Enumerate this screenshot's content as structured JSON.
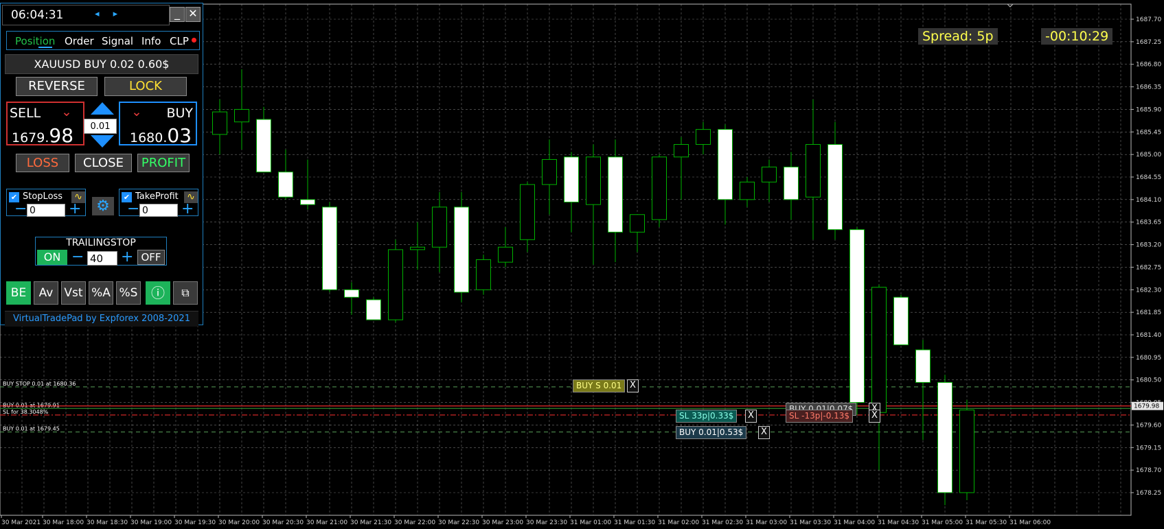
{
  "colors": {
    "background": "#000000",
    "grid": "#d0d0d0",
    "bull": "#00b300",
    "bear_body": "#ffffff",
    "accent_blue": "#1e90ff",
    "green_button": "#1db35a",
    "loss_text": "#ff6a3d",
    "lock_text": "#ffe033",
    "profit_text": "#33ff66",
    "hud_text": "#ffff4d",
    "bid_line": "#ff3030"
  },
  "hud": {
    "spread": "Spread: 5p",
    "timer": "-00:10:29"
  },
  "chart_data": {
    "type": "candlestick",
    "symbol": "XAUUSD",
    "y_ticks": [
      "1687.70",
      "1687.25",
      "1686.80",
      "1686.35",
      "1685.90",
      "1685.45",
      "1685.00",
      "1684.55",
      "1684.10",
      "1683.65",
      "1683.20",
      "1682.75",
      "1682.30",
      "1681.85",
      "1681.40",
      "1680.95",
      "1680.50",
      "1680.05",
      "1679.60",
      "1679.15",
      "1678.70",
      "1678.25"
    ],
    "ylim": [
      1677.9,
      1688.0
    ],
    "current_price_label": "1679.98",
    "x_ticks": [
      "30 Mar 2021",
      "30 Mar 18:00",
      "30 Mar 18:30",
      "30 Mar 19:00",
      "30 Mar 19:30",
      "30 Mar 20:00",
      "30 Mar 20:30",
      "30 Mar 21:00",
      "30 Mar 21:30",
      "30 Mar 22:00",
      "30 Mar 22:30",
      "30 Mar 23:00",
      "30 Mar 23:30",
      "31 Mar 01:00",
      "31 Mar 01:30",
      "31 Mar 02:00",
      "31 Mar 02:30",
      "31 Mar 03:00",
      "31 Mar 03:30",
      "31 Mar 04:00",
      "31 Mar 04:30",
      "31 Mar 05:00",
      "31 Mar 05:30",
      "31 Mar 06:00"
    ],
    "candles": [
      {
        "o": 1685.4,
        "h": 1686.1,
        "l": 1685.0,
        "c": 1685.85
      },
      {
        "o": 1685.65,
        "h": 1686.7,
        "l": 1685.1,
        "c": 1685.9
      },
      {
        "o": 1685.7,
        "h": 1685.95,
        "l": 1684.65,
        "c": 1684.65
      },
      {
        "o": 1684.65,
        "h": 1685.1,
        "l": 1684.1,
        "c": 1684.15
      },
      {
        "o": 1684.1,
        "h": 1684.9,
        "l": 1683.9,
        "c": 1684.0
      },
      {
        "o": 1683.95,
        "h": 1684.05,
        "l": 1682.25,
        "c": 1682.3
      },
      {
        "o": 1682.3,
        "h": 1682.45,
        "l": 1681.8,
        "c": 1682.15
      },
      {
        "o": 1682.1,
        "h": 1682.15,
        "l": 1681.75,
        "c": 1681.7
      },
      {
        "o": 1681.7,
        "h": 1683.3,
        "l": 1681.65,
        "c": 1683.1
      },
      {
        "o": 1683.1,
        "h": 1683.65,
        "l": 1682.7,
        "c": 1683.15
      },
      {
        "o": 1683.15,
        "h": 1684.25,
        "l": 1682.65,
        "c": 1683.95
      },
      {
        "o": 1683.95,
        "h": 1684.25,
        "l": 1682.05,
        "c": 1682.25
      },
      {
        "o": 1682.3,
        "h": 1683.0,
        "l": 1682.2,
        "c": 1682.9
      },
      {
        "o": 1682.85,
        "h": 1683.55,
        "l": 1682.75,
        "c": 1683.15
      },
      {
        "o": 1683.3,
        "h": 1684.45,
        "l": 1683.05,
        "c": 1684.4
      },
      {
        "o": 1684.4,
        "h": 1685.3,
        "l": 1683.8,
        "c": 1684.9
      },
      {
        "o": 1684.95,
        "h": 1685.05,
        "l": 1683.45,
        "c": 1684.05
      },
      {
        "o": 1684.0,
        "h": 1685.2,
        "l": 1682.8,
        "c": 1684.95
      },
      {
        "o": 1684.95,
        "h": 1685.3,
        "l": 1682.85,
        "c": 1683.45
      },
      {
        "o": 1683.45,
        "h": 1683.7,
        "l": 1683.05,
        "c": 1683.8
      },
      {
        "o": 1683.7,
        "h": 1685.0,
        "l": 1683.55,
        "c": 1684.95
      },
      {
        "o": 1684.95,
        "h": 1685.35,
        "l": 1684.1,
        "c": 1685.2
      },
      {
        "o": 1685.2,
        "h": 1685.65,
        "l": 1685.0,
        "c": 1685.5
      },
      {
        "o": 1685.5,
        "h": 1685.6,
        "l": 1683.6,
        "c": 1684.1
      },
      {
        "o": 1684.1,
        "h": 1684.55,
        "l": 1683.95,
        "c": 1684.45
      },
      {
        "o": 1684.45,
        "h": 1684.9,
        "l": 1684.05,
        "c": 1684.75
      },
      {
        "o": 1684.75,
        "h": 1685.05,
        "l": 1683.7,
        "c": 1684.1
      },
      {
        "o": 1684.15,
        "h": 1686.1,
        "l": 1683.3,
        "c": 1685.2
      },
      {
        "o": 1685.2,
        "h": 1685.65,
        "l": 1683.3,
        "c": 1683.5
      },
      {
        "o": 1683.5,
        "h": 1683.55,
        "l": 1679.8,
        "c": 1680.05
      },
      {
        "o": 1679.85,
        "h": 1682.4,
        "l": 1678.7,
        "c": 1682.35
      },
      {
        "o": 1682.15,
        "h": 1682.2,
        "l": 1681.2,
        "c": 1681.2
      },
      {
        "o": 1681.1,
        "h": 1681.3,
        "l": 1679.3,
        "c": 1680.45
      },
      {
        "o": 1680.45,
        "h": 1680.6,
        "l": 1678.0,
        "c": 1678.25
      },
      {
        "o": 1678.25,
        "h": 1680.1,
        "l": 1678.1,
        "c": 1679.9
      }
    ],
    "levels": [
      {
        "label": "BUY STOP 0.01 at 1680.36",
        "price": 1680.36,
        "style": "dashed",
        "color": "#5aa05a"
      },
      {
        "label": "BUY 0.01 at 1679.91",
        "price": 1679.93,
        "style": "solid",
        "color": "#2e8b2e"
      },
      {
        "label": "SL for 38.3048%",
        "price": 1679.8,
        "style": "dashdot",
        "color": "#ff3030"
      },
      {
        "label": "BUY 0.01 at 1679.45",
        "price": 1679.46,
        "style": "dashed",
        "color": "#5aa05a"
      },
      {
        "label": "",
        "price": 1679.98,
        "style": "solid",
        "color": "#ff3030"
      }
    ]
  },
  "order_tags": [
    {
      "name": "tag-buy-stop",
      "text": "BUY S 0.01",
      "bg": "#7a7a1a",
      "color": "#ffff88",
      "x_label": "X"
    },
    {
      "name": "tag-sl-33",
      "text": "SL 33p|0.33$",
      "bg": "#0b5a52",
      "color": "#8affe8",
      "x_label": "X"
    },
    {
      "name": "tag-buy-053",
      "text": "BUY 0.01|0.53$",
      "bg": "#1c3a4a",
      "color": "#ffffff",
      "x_label": "X"
    },
    {
      "name": "tag-buy-007",
      "text": "BUY 0.01|0.07$",
      "bg": "#404040",
      "color": "#e0e0e0",
      "x_label": "X"
    },
    {
      "name": "tag-sl-13",
      "text": "SL -13p|-0.13$",
      "bg": "#4a2020",
      "color": "#ff7a6a",
      "x_label": "X"
    }
  ],
  "panel": {
    "time": "06:04:31",
    "nav_arrows": "◂ ▸",
    "minimize": "_",
    "close": "✕",
    "tabs": [
      "Position",
      "Order",
      "Signal",
      "Info",
      "CLP"
    ],
    "position_summary": "XAUUSD BUY 0.02 0.60$",
    "reverse": "REVERSE",
    "lock": "LOCK",
    "sell_label": "SELL",
    "buy_label": "BUY",
    "sell_price_small": "1679.",
    "sell_price_big": "98",
    "buy_price_small": "1680.",
    "buy_price_big": "03",
    "volume": "0.01",
    "loss": "LOSS",
    "close_btn": "CLOSE",
    "profit": "PROFIT",
    "stoploss_label": "StopLoss",
    "takeprofit_label": "TakeProfit",
    "sl_value": "0",
    "tp_value": "0",
    "trailing_title": "TRAILINGSTOP",
    "trailing_on": "ON",
    "trailing_value": "40",
    "trailing_off": "OFF",
    "tools": [
      "BE",
      "Av",
      "Vst",
      "%A",
      "%S"
    ],
    "footer": "VirtualTradePad by Expforex 2008-2021"
  }
}
